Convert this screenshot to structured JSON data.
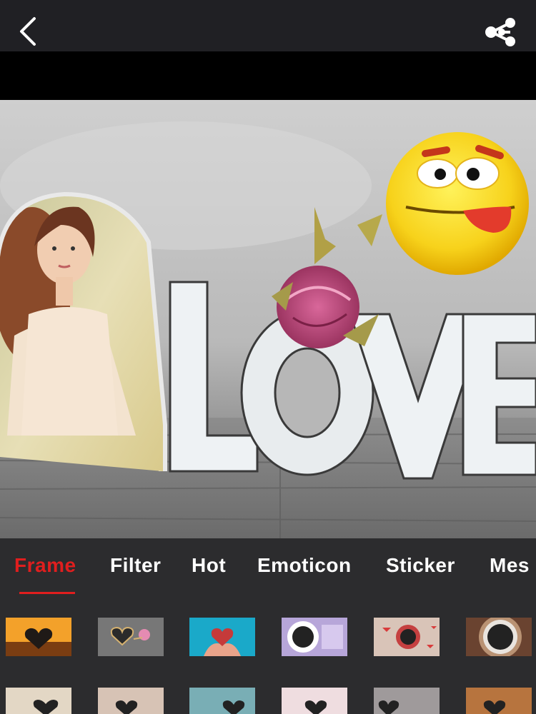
{
  "header": {
    "back_icon": "back-arrow-icon",
    "share_icon": "share-icon"
  },
  "tabs": [
    {
      "label": "Frame",
      "active": true
    },
    {
      "label": "Filter",
      "active": false
    },
    {
      "label": "Hot",
      "active": false
    },
    {
      "label": "Emoticon",
      "active": false
    },
    {
      "label": "Sticker",
      "active": false
    },
    {
      "label": "Mes",
      "active": false
    }
  ],
  "colors": {
    "accent": "#e01e1e",
    "topbar": "#202024",
    "panel": "#2c2c2e"
  },
  "frames_row1": [
    "frame-heart-book",
    "frame-hearts-chalk",
    "frame-heart-hands",
    "frame-coffee-purple",
    "frame-coffee-hearts",
    "frame-coffee-cup"
  ],
  "frames_row2": [
    "frame-heart-paper",
    "frame-heart-card",
    "frame-heart-teal",
    "frame-heart-pink",
    "frame-heart-gray",
    "frame-heart-wood"
  ]
}
